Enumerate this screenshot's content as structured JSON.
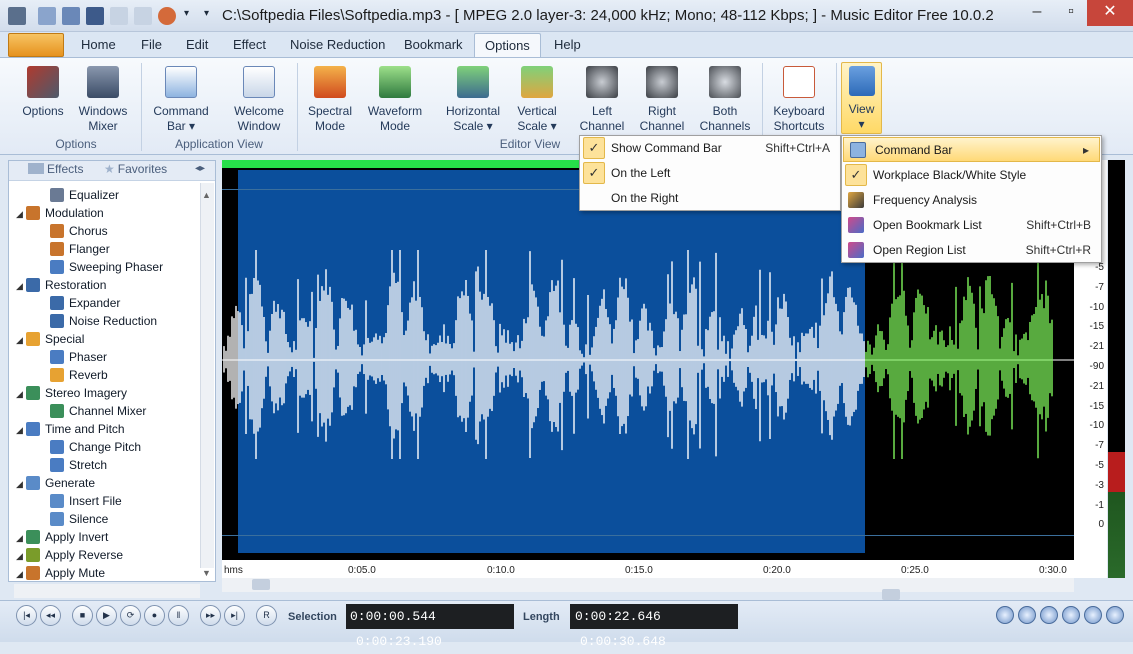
{
  "window": {
    "title": "C:\\Softpedia Files\\Softpedia.mp3 - [ MPEG 2.0 layer-3: 24,000 kHz; Mono; 48-112 Kbps;  ] - Music Editor Free 10.0.2"
  },
  "tabs": [
    "Home",
    "File",
    "Edit",
    "Effect",
    "Noise Reduction",
    "Bookmark",
    "Options",
    "Help"
  ],
  "ribbon": {
    "buttons": {
      "options": "Options",
      "windows_mixer_1": "Windows",
      "windows_mixer_2": "Mixer",
      "command_bar_1": "Command",
      "command_bar_2": "Bar ▾",
      "welcome_1": "Welcome",
      "welcome_2": "Window",
      "spectral_1": "Spectral",
      "spectral_2": "Mode",
      "waveform_1": "Waveform",
      "waveform_2": "Mode",
      "hscale_1": "Horizontal",
      "hscale_2": "Scale ▾",
      "vscale_1": "Vertical",
      "vscale_2": "Scale ▾",
      "left_1": "Left",
      "left_2": "Channel",
      "right_1": "Right",
      "right_2": "Channel",
      "both_1": "Both",
      "both_2": "Channels",
      "keyboard_1": "Keyboard",
      "keyboard_2": "Shortcuts",
      "view": "View",
      "view_arrow": "▾"
    },
    "groups": {
      "options": "Options",
      "application_view": "Application View",
      "editor_view": "Editor View"
    }
  },
  "panel": {
    "tab_effects": "Effects",
    "tab_favorites": "Favorites",
    "tree": [
      {
        "label": "Equalizer",
        "level": 2,
        "color": "#6a7a94"
      },
      {
        "label": "Modulation",
        "level": 1,
        "color": "#c8742c"
      },
      {
        "label": "Chorus",
        "level": 2,
        "color": "#c8742c"
      },
      {
        "label": "Flanger",
        "level": 2,
        "color": "#c8742c"
      },
      {
        "label": "Sweeping Phaser",
        "level": 2,
        "color": "#4a7cc2"
      },
      {
        "label": "Restoration",
        "level": 1,
        "color": "#3b6aa8"
      },
      {
        "label": "Expander",
        "level": 2,
        "color": "#3b6aa8"
      },
      {
        "label": "Noise Reduction",
        "level": 2,
        "color": "#3b6aa8"
      },
      {
        "label": "Special",
        "level": 1,
        "color": "#e7a232"
      },
      {
        "label": "Phaser",
        "level": 2,
        "color": "#4a7cc2"
      },
      {
        "label": "Reverb",
        "level": 2,
        "color": "#e7a232"
      },
      {
        "label": "Stereo Imagery",
        "level": 1,
        "color": "#3b8f5a"
      },
      {
        "label": "Channel Mixer",
        "level": 2,
        "color": "#3b8f5a"
      },
      {
        "label": "Time and Pitch",
        "level": 1,
        "color": "#4a7cc2"
      },
      {
        "label": "Change Pitch",
        "level": 2,
        "color": "#4a7cc2"
      },
      {
        "label": "Stretch",
        "level": 2,
        "color": "#4a7cc2"
      },
      {
        "label": "Generate",
        "level": 1,
        "color": "#5a8bc8"
      },
      {
        "label": "Insert File",
        "level": 2,
        "color": "#5a8bc8"
      },
      {
        "label": "Silence",
        "level": 2,
        "color": "#5a8bc8"
      },
      {
        "label": "Apply Invert",
        "level": 1,
        "color": "#3b8f5a"
      },
      {
        "label": "Apply Reverse",
        "level": 1,
        "color": "#7a9c2a"
      },
      {
        "label": "Apply Mute",
        "level": 1,
        "color": "#c8742c"
      }
    ]
  },
  "timeline": {
    "unit": "hms",
    "ticks": [
      "0:05.0",
      "0:10.0",
      "0:15.0",
      "0:20.0",
      "0:25.0",
      "0:30.0"
    ]
  },
  "db_scale": [
    "-5",
    "-7",
    "-10",
    "-15",
    "-21",
    "-90",
    "-21",
    "-15",
    "-10",
    "-7",
    "-5",
    "-3",
    "-1",
    "0"
  ],
  "transport": {
    "selection_label": "Selection",
    "selection_start": "0:00:00.544",
    "selection_end": "0:00:23.190",
    "length_label": "Length",
    "length_value": "0:00:22.646",
    "total_value": "0:00:30.648"
  },
  "menus": {
    "command_bar_menu": [
      {
        "label": "Show Command Bar",
        "shortcut": "Shift+Ctrl+A",
        "checked": true
      },
      {
        "label": "On the Left",
        "shortcut": "",
        "checked": true
      },
      {
        "label": "On the Right",
        "shortcut": "",
        "checked": false
      }
    ],
    "view_menu": [
      {
        "label": "Command Bar",
        "shortcut": "",
        "icon": "command-bar-icon",
        "submenu": true
      },
      {
        "label": "Workplace Black/White Style",
        "shortcut": "",
        "checked": true
      },
      {
        "label": "Frequency Analysis",
        "shortcut": "",
        "icon": "frequency-icon"
      },
      {
        "label": "Open Bookmark List",
        "shortcut": "Shift+Ctrl+B",
        "icon": "bookmark-list-icon"
      },
      {
        "label": "Open Region List",
        "shortcut": "Shift+Ctrl+R",
        "icon": "region-list-icon"
      }
    ]
  },
  "colors": {
    "selection_blue": "#0b4f9c",
    "waveform_green": "#7df25a",
    "waveform_white": "#ffffff",
    "accent_orange": "#e6921e"
  }
}
